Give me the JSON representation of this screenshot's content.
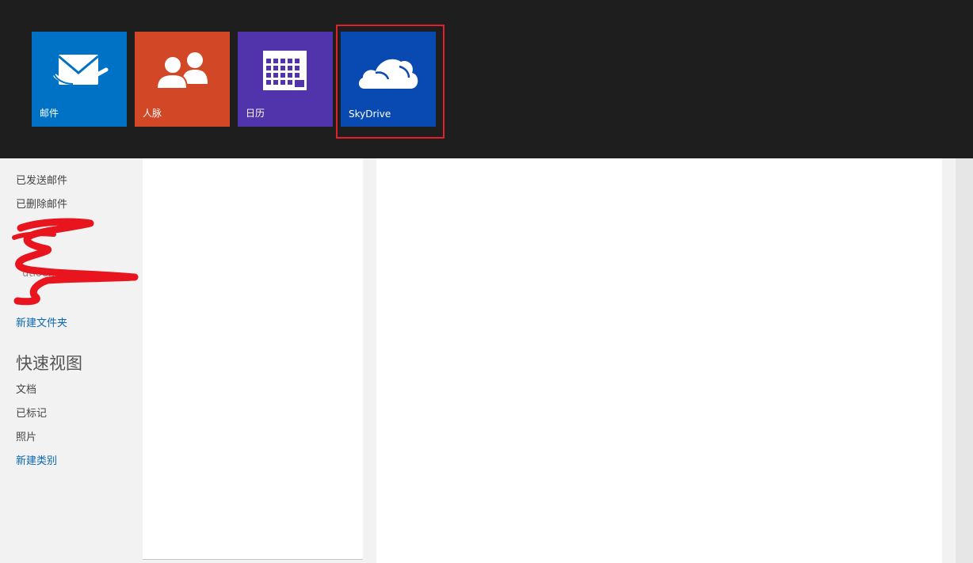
{
  "app_bar": {
    "tiles": [
      {
        "label": "邮件",
        "icon": "mail-icon",
        "color": "#0072c6"
      },
      {
        "label": "人脉",
        "icon": "people-icon",
        "color": "#d24726"
      },
      {
        "label": "日历",
        "icon": "calendar-icon",
        "color": "#5133ab"
      },
      {
        "label": "SkyDrive",
        "icon": "cloud-icon",
        "color": "#094ab2"
      }
    ],
    "highlight_color": "#e3202a",
    "background": "#1e1e1e"
  },
  "sidebar": {
    "folders": [
      {
        "label": "已发送邮件"
      },
      {
        "label": "已删除邮件"
      }
    ],
    "redacted_account": "utlook.com",
    "new_folder_link": "新建文件夹",
    "quick_views_heading": "快速视图",
    "quick_views": [
      {
        "label": "文档"
      },
      {
        "label": "已标记"
      },
      {
        "label": "照片"
      }
    ],
    "new_category_link": "新建类别"
  }
}
